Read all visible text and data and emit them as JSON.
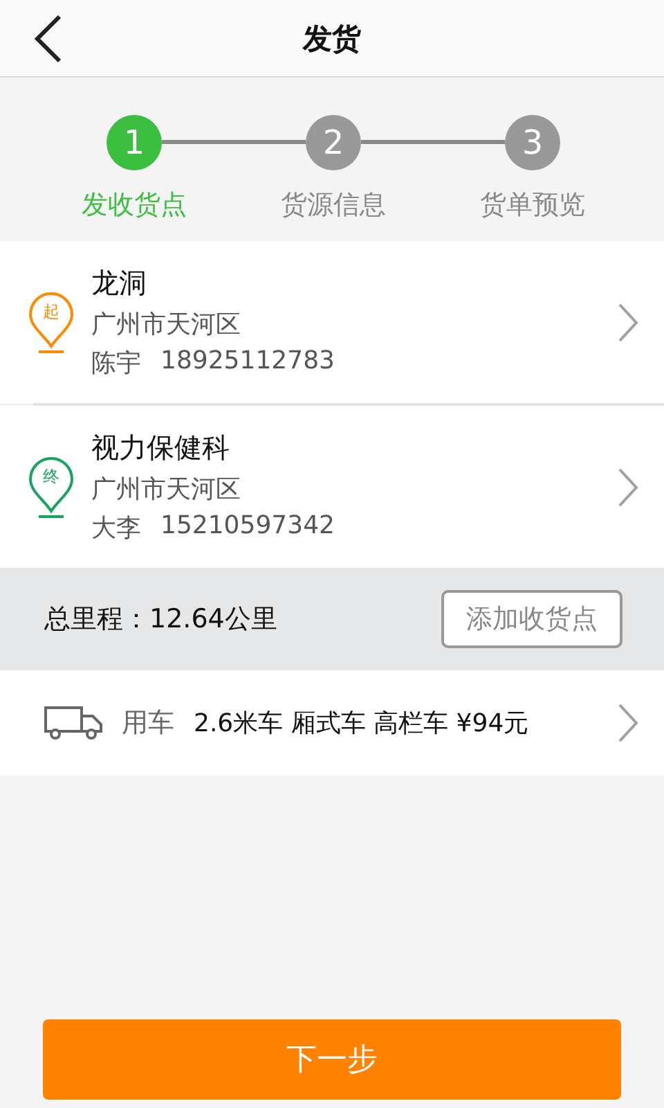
{
  "header": {
    "title": "发货"
  },
  "steps": [
    {
      "number": "1",
      "label": "发收货点",
      "selected": true
    },
    {
      "number": "2",
      "label": "货源信息",
      "selected": false
    },
    {
      "number": "3",
      "label": "货单预览",
      "selected": false
    }
  ],
  "stops": [
    {
      "badge": "起",
      "color": "#ff8a00",
      "name": "龙洞",
      "address": "广州市天河区",
      "contact_name": "陈宇",
      "phone": "18925112783"
    },
    {
      "badge": "终",
      "color": "#1aa260",
      "name": "视力保健科",
      "address": "广州市天河区",
      "contact_name": "大李",
      "phone": "15210597342"
    }
  ],
  "distance": {
    "label": "总里程：12.64公里",
    "button": "添加收货点"
  },
  "vehicle": {
    "label": "用车",
    "detail": "2.6米车 厢式车 高栏车 ¥94元"
  },
  "next_button": "下一步"
}
